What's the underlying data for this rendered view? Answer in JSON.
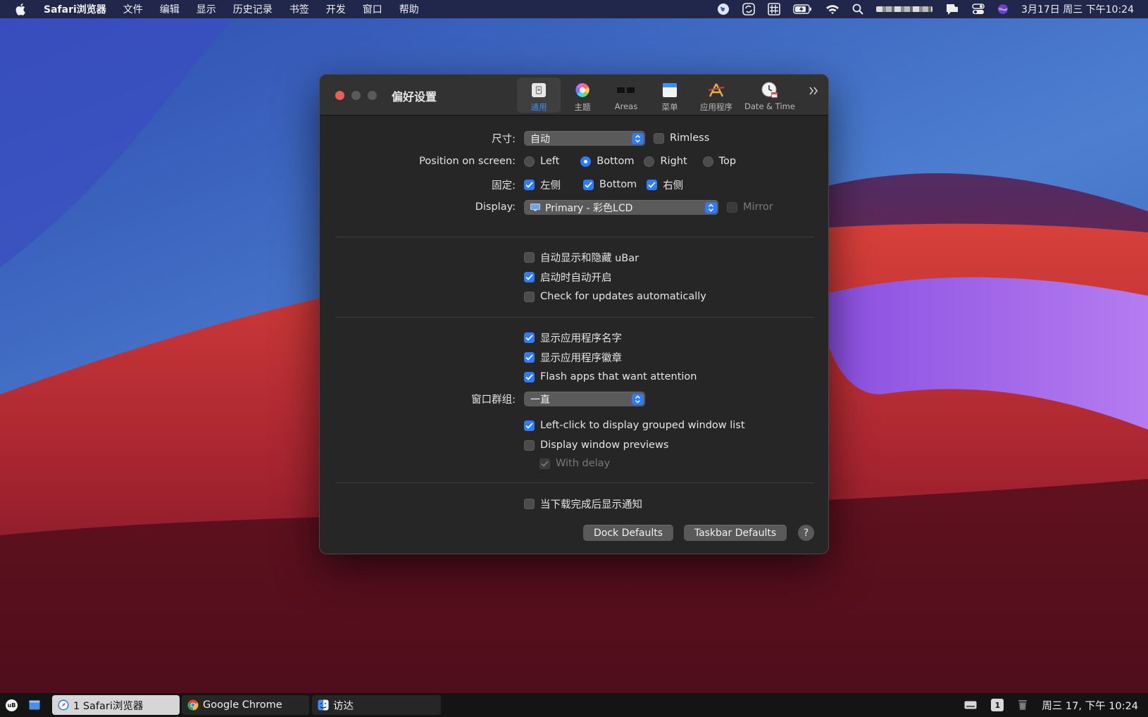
{
  "menubar": {
    "app_name": "Safari浏览器",
    "items": [
      "文件",
      "编辑",
      "显示",
      "历史记录",
      "书签",
      "开发",
      "窗口",
      "帮助"
    ],
    "clock": "3月17日 周三 下午10:24"
  },
  "window": {
    "title": "偏好设置",
    "tabs": [
      {
        "label": "通用",
        "icon": "general-icon",
        "active": true
      },
      {
        "label": "主题",
        "icon": "theme-color-wheel-icon",
        "active": false
      },
      {
        "label": "Areas",
        "icon": "areas-icon",
        "active": false
      },
      {
        "label": "菜单",
        "icon": "menu-icon",
        "active": false
      },
      {
        "label": "应用程序",
        "icon": "applications-icon",
        "active": false
      },
      {
        "label": "Date & Time",
        "icon": "clock-icon",
        "active": false
      }
    ],
    "general": {
      "size": {
        "label": "尺寸:",
        "value": "自动",
        "rimless_label": "Rimless",
        "rimless_checked": false
      },
      "position": {
        "label": "Position on screen:",
        "options": [
          {
            "label": "Left",
            "selected": false
          },
          {
            "label": "Bottom",
            "selected": true
          },
          {
            "label": "Right",
            "selected": false
          },
          {
            "label": "Top",
            "selected": false
          }
        ]
      },
      "pin": {
        "label": "固定:",
        "options": [
          {
            "label": "左侧",
            "checked": true
          },
          {
            "label": "Bottom",
            "checked": true
          },
          {
            "label": "右侧",
            "checked": true
          }
        ]
      },
      "display": {
        "label": "Display:",
        "value": "Primary - 彩色LCD",
        "mirror_label": "Mirror",
        "mirror_checked": false
      },
      "group1": [
        {
          "label": "自动显示和隐藏 uBar",
          "checked": false
        },
        {
          "label": "启动时自动开启",
          "checked": true
        },
        {
          "label": "Check for updates automatically",
          "checked": false
        }
      ],
      "group2": [
        {
          "label": "显示应用程序名字",
          "checked": true
        },
        {
          "label": "显示应用程序徽章",
          "checked": true
        },
        {
          "label": "Flash apps that want attention",
          "checked": true
        }
      ],
      "window_group": {
        "label": "窗口群组:",
        "value": "一直"
      },
      "group3": [
        {
          "label": "Left-click to display grouped window list",
          "checked": true
        },
        {
          "label": "Display window previews",
          "checked": false
        }
      ],
      "with_delay": {
        "label": "With delay",
        "checked": true
      },
      "notify": {
        "label": "当下载完成后显示通知",
        "checked": false
      },
      "buttons": {
        "dock_defaults": "Dock Defaults",
        "taskbar_defaults": "Taskbar Defaults",
        "help": "?"
      }
    }
  },
  "taskbar": {
    "ubar_logo": "uB",
    "apps": [
      {
        "label": "1 Safari浏览器",
        "icon": "safari-icon",
        "active": true
      },
      {
        "label": "Google Chrome",
        "icon": "chrome-icon",
        "active": false
      },
      {
        "label": "访达",
        "icon": "finder-icon",
        "active": false
      }
    ],
    "desktop_badge": "1",
    "clock": "周三 17, 下午 10:24"
  }
}
